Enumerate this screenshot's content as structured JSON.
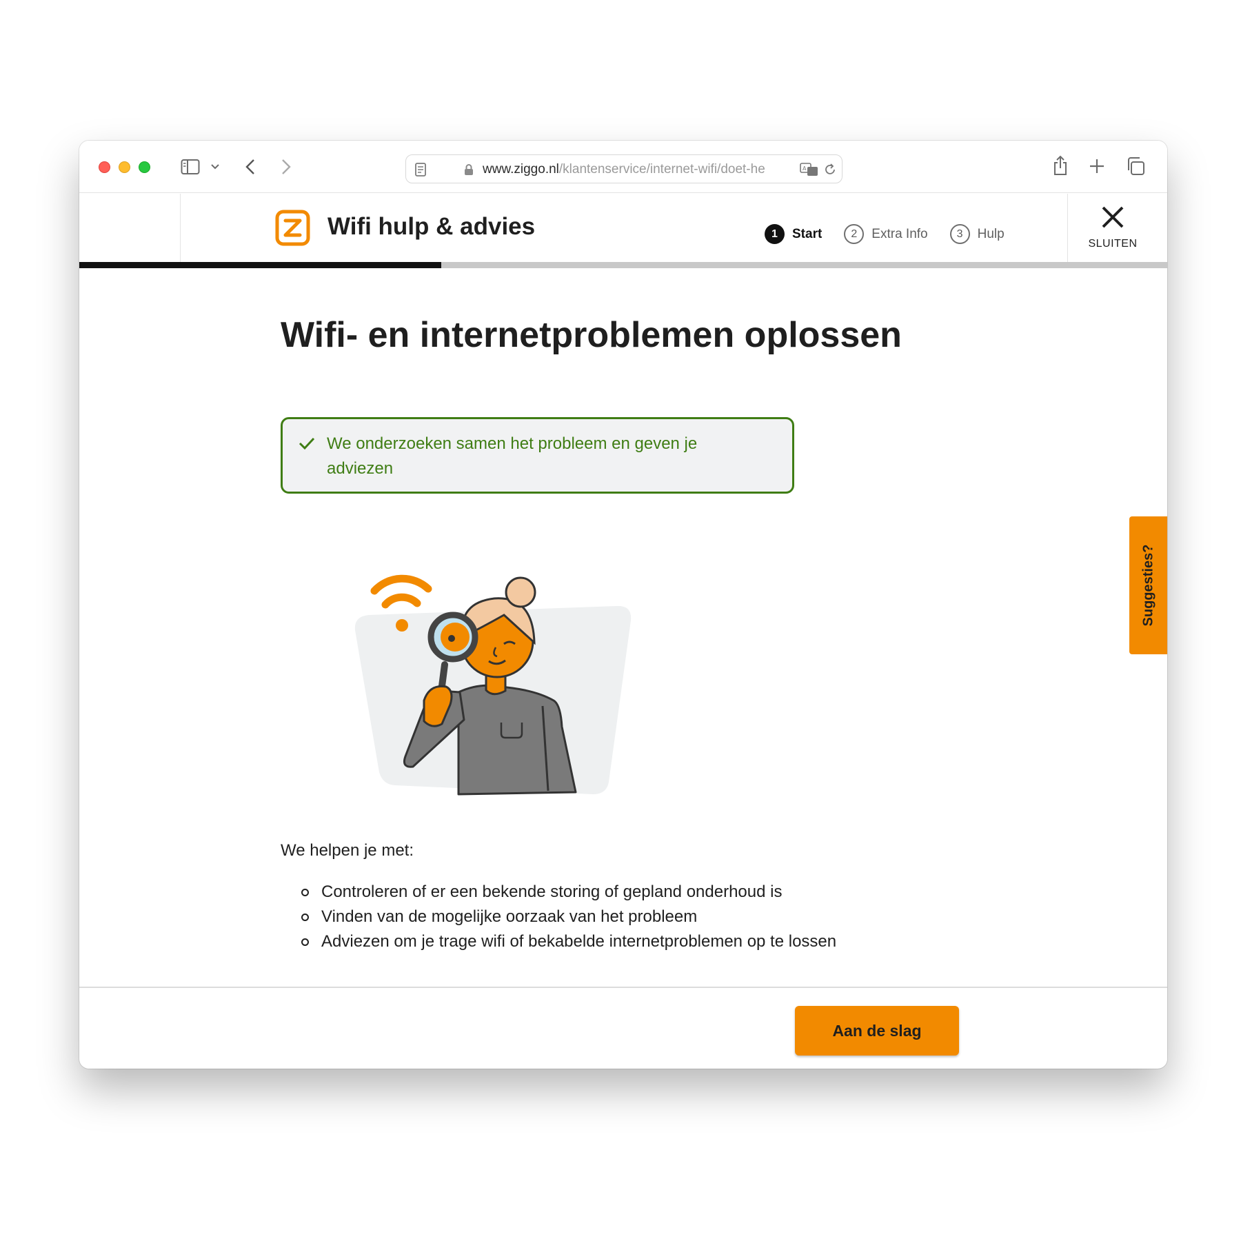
{
  "browser": {
    "url_host": "www.ziggo.nl",
    "url_path": "/klantenservice/internet-wifi/doet-he"
  },
  "header": {
    "brand_title": "Wifi hulp & advies",
    "steps": [
      {
        "number": "1",
        "label": "Start",
        "active": true
      },
      {
        "number": "2",
        "label": "Extra Info",
        "active": false
      },
      {
        "number": "3",
        "label": "Hulp",
        "active": false
      }
    ],
    "close_label": "SLUITEN",
    "progress": 0.333
  },
  "main": {
    "title": "Wifi- en internetproblemen oplossen",
    "notice": "We onderzoeken samen het probleem en geven je adviezen",
    "intro": "We helpen je met:",
    "bullets": [
      "Controleren of er een bekende storing of gepland onderhoud is",
      "Vinden van de mogelijke oorzaak van het probleem",
      "Adviezen om je trage wifi of bekabelde internetproblemen op te lossen"
    ]
  },
  "footer": {
    "cta_label": "Aan de slag"
  },
  "side_tab": {
    "label": "Suggesties?"
  },
  "colors": {
    "brand_orange": "#f28a00",
    "success_green": "#3f7d14",
    "text_dark": "#1f1f1f"
  },
  "icons": {
    "sidebar": "sidebar-toggle-icon",
    "back": "chevron-left-icon",
    "forward": "chevron-right-icon",
    "lock": "lock-icon",
    "reload": "reload-icon",
    "share": "share-icon",
    "new_tab": "plus-icon",
    "tabs": "tabs-overview-icon",
    "close": "close-icon",
    "check": "check-icon"
  }
}
